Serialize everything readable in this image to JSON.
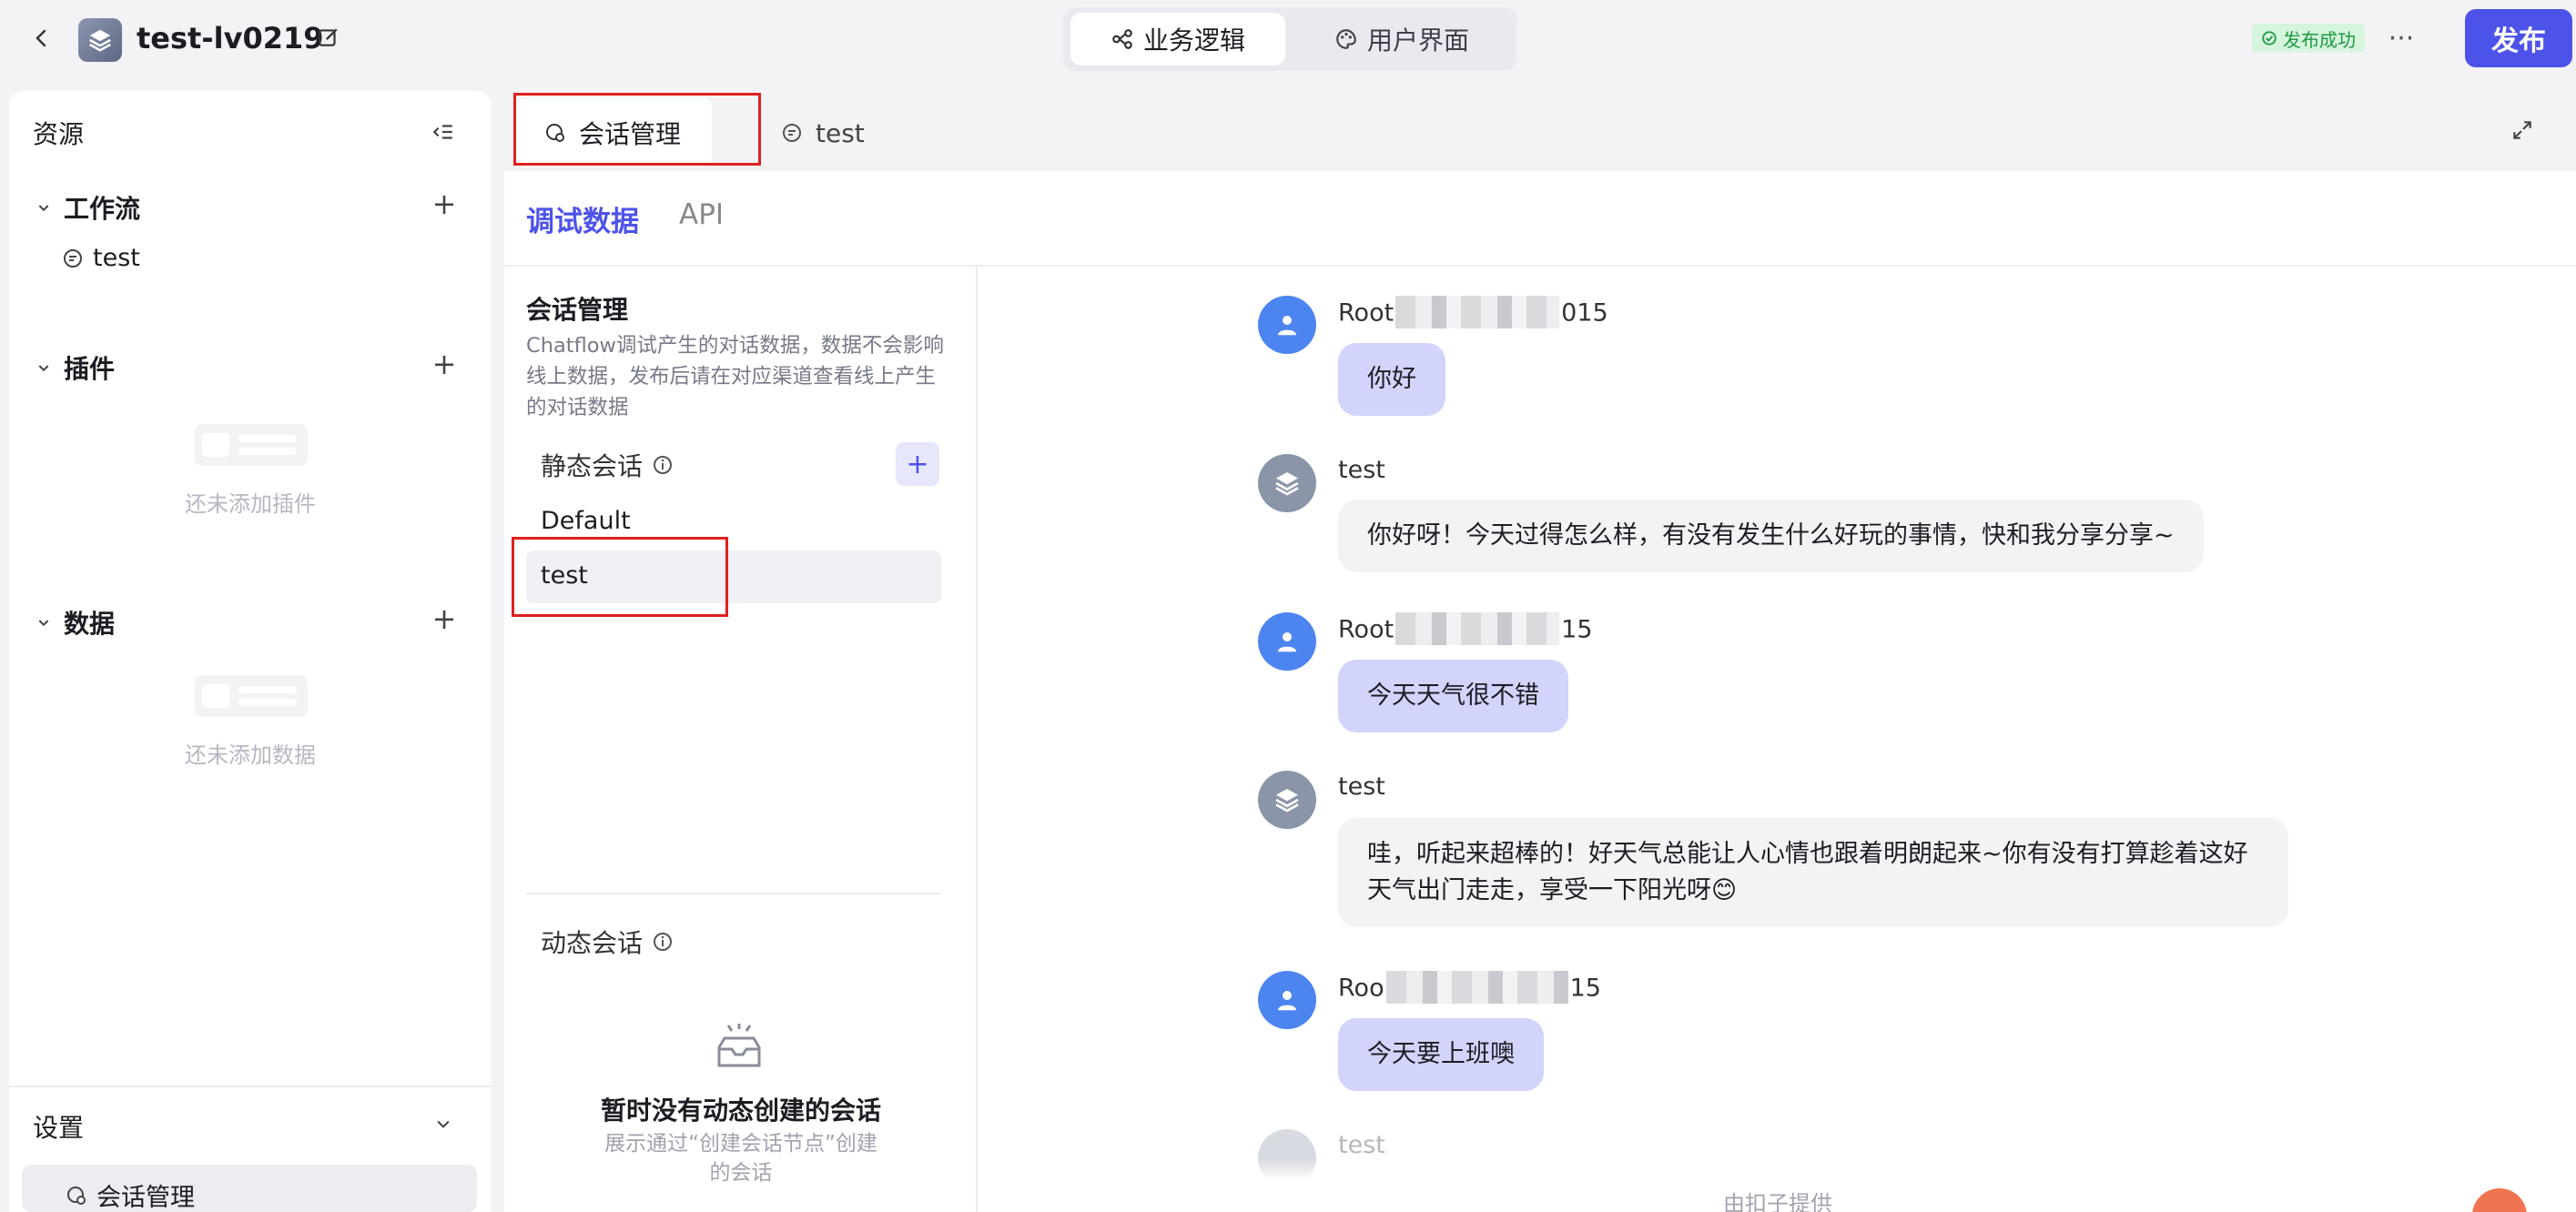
{
  "topbar": {
    "app_title": "test-lv0219",
    "mode_tabs": [
      {
        "label": "业务逻辑",
        "active": true
      },
      {
        "label": "用户界面",
        "active": false
      }
    ],
    "status_badge": "发布成功",
    "more_label": "···",
    "publish_label": "发布"
  },
  "sidebar": {
    "header": "资源",
    "workflow": {
      "label": "工作流",
      "items": [
        "test"
      ]
    },
    "plugin": {
      "label": "插件",
      "empty_text": "还未添加插件"
    },
    "data": {
      "label": "数据",
      "empty_text": "还未添加数据"
    },
    "settings": {
      "label": "设置",
      "items": [
        "会话管理"
      ]
    }
  },
  "editor_tabs": [
    {
      "label": "会话管理",
      "active": true
    },
    {
      "label": "test",
      "active": false
    }
  ],
  "sub_tabs": [
    {
      "label": "调试数据",
      "active": true
    },
    {
      "label": "API",
      "active": false
    }
  ],
  "conversation_panel": {
    "title": "会话管理",
    "description": "Chatflow调试产生的对话数据，数据不会影响线上数据，发布后请在对应渠道查看线上产生的对话数据",
    "static_label": "静态会话",
    "static_add": "+",
    "static_items": [
      "Default",
      "test"
    ],
    "selected": "test",
    "dynamic_label": "动态会话",
    "dynamic_empty_title": "暂时没有动态创建的会话",
    "dynamic_empty_desc": "展示通过“创建会话节点”创建的会话"
  },
  "chat": {
    "messages": [
      {
        "role": "user",
        "sender_prefix": "Root",
        "sender_suffix": "015",
        "text": "你好"
      },
      {
        "role": "bot",
        "sender_prefix": "test",
        "sender_suffix": "",
        "text": "你好呀！今天过得怎么样，有没有发生什么好玩的事情，快和我分享分享~"
      },
      {
        "role": "user",
        "sender_prefix": "Root",
        "sender_suffix": "15",
        "text": "今天天气很不错"
      },
      {
        "role": "bot",
        "sender_prefix": "test",
        "sender_suffix": "",
        "text": "哇，听起来超棒的！好天气总能让人心情也跟着明朗起来~你有没有打算趁着这好天气出门走走，享受一下阳光呀😊"
      },
      {
        "role": "user",
        "sender_prefix": "Roo",
        "sender_suffix": "15",
        "text": "今天要上班噢"
      },
      {
        "role": "bot",
        "sender_prefix": "test",
        "sender_suffix": "",
        "text": ""
      }
    ],
    "footer": "由扣子提供"
  },
  "colors": {
    "accent": "#4d53e8",
    "user_bubble": "#d2d4fb",
    "bot_bubble": "#f3f3f6",
    "highlight": "#e0201f",
    "success": "#1e9b44"
  }
}
